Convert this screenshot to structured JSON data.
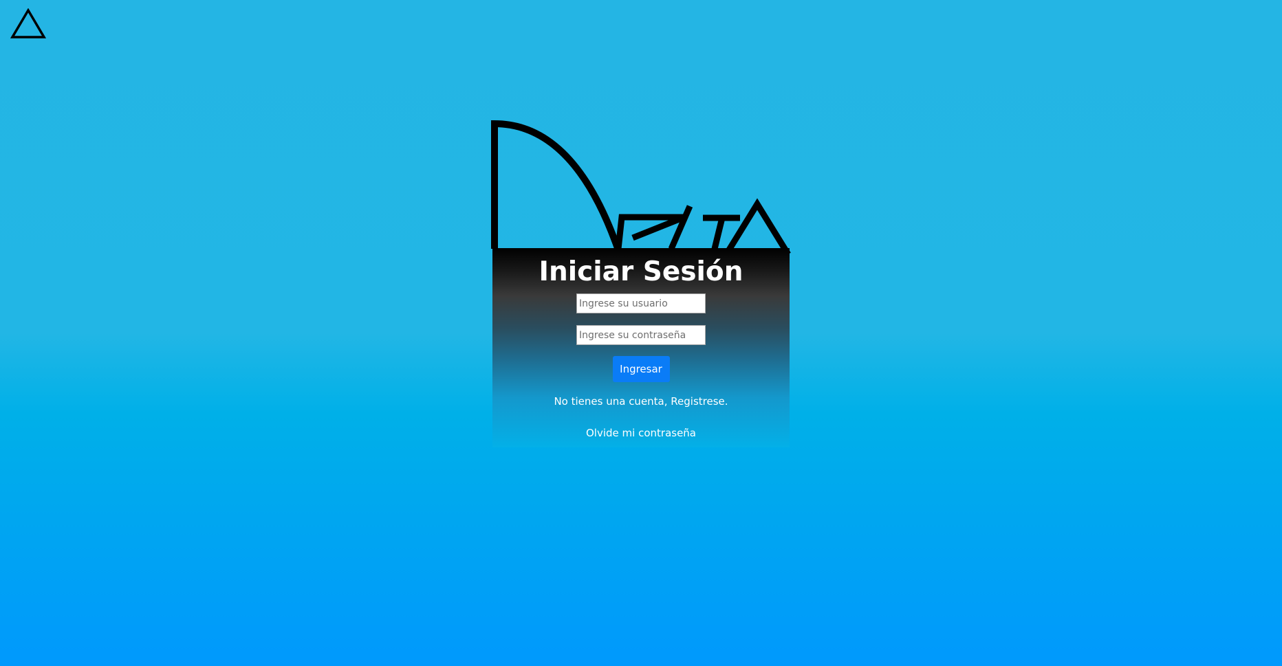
{
  "brand": {
    "corner_icon": "delta-triangle-icon",
    "logo_icon": "delta-wordmark-logo"
  },
  "login": {
    "title": "Iniciar Sesión",
    "username_placeholder": "Ingrese su usuario",
    "username_value": "",
    "password_placeholder": "Ingrese su contraseña",
    "password_value": "",
    "submit_label": "Ingresar",
    "register_text": "No tienes una cuenta, Registrese.",
    "forgot_text": "Olvide mi contraseña"
  },
  "colors": {
    "background_top": "#24b5e4",
    "background_bottom": "#0099fd",
    "button": "#0a7cf7",
    "card_top": "#000000"
  }
}
